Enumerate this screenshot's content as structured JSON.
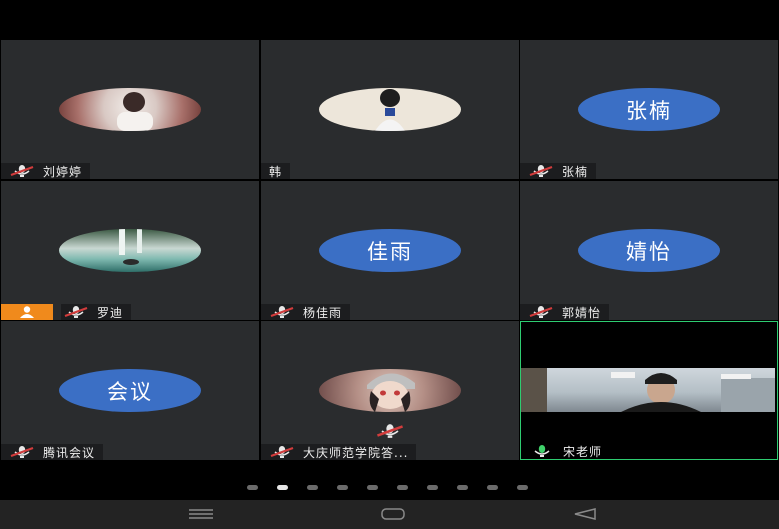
{
  "participants": [
    {
      "name": "刘婷婷"
    },
    {
      "name": "韩"
    },
    {
      "name": "张楠",
      "avatar_text": "张楠"
    },
    {
      "name": "罗迪"
    },
    {
      "name": "杨佳雨",
      "avatar_text": "佳雨"
    },
    {
      "name": "郭婧怡",
      "avatar_text": "婧怡"
    },
    {
      "name": "腾讯会议",
      "avatar_text": "会议"
    },
    {
      "name": "大庆师范学院答..."
    },
    {
      "name": "宋老师"
    }
  ],
  "colors": {
    "tile_bg": "#2a2c2e",
    "avatar_blue": "#3b6fc5",
    "host_badge": "#f08a1c",
    "active_speaker_border": "#2ecc71",
    "mic_muted": "#d23c3c",
    "mic_active": "#3fd16a"
  },
  "pager": {
    "page_count": 10,
    "active_page": 2
  },
  "icons": {
    "mic_muted": "mic-muted-icon",
    "mic_active": "mic-icon",
    "host": "person-icon",
    "nav_menu": "menu-icon",
    "nav_home": "home-icon",
    "nav_back": "back-icon"
  }
}
